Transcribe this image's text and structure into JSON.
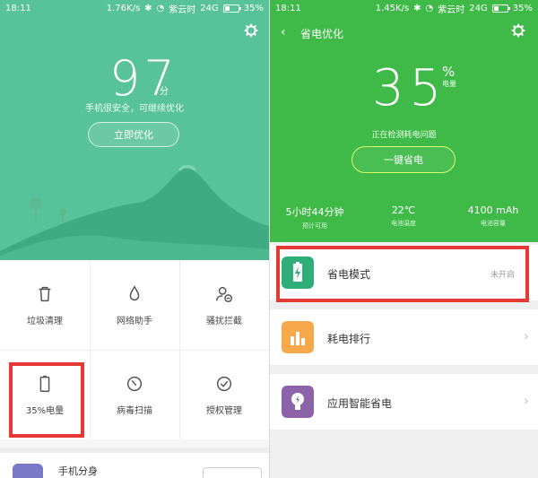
{
  "left": {
    "status": {
      "time": "18:11",
      "speed": "1.76K/s",
      "network": "紫云时",
      "signal": "24G",
      "battery": "35%"
    },
    "score": "97",
    "score_unit": "分",
    "subtitle": "手机很安全，可继续优化",
    "optimize_button": "立即优化",
    "grid": [
      {
        "label": "垃圾清理",
        "icon": "trash-icon"
      },
      {
        "label": "网络助手",
        "icon": "droplet-icon"
      },
      {
        "label": "骚扰拦截",
        "icon": "user-block-icon"
      },
      {
        "label": "35%电量",
        "icon": "battery-icon"
      },
      {
        "label": "病毒扫描",
        "icon": "scan-icon"
      },
      {
        "label": "授权管理",
        "icon": "check-circle-icon"
      }
    ],
    "bottom": {
      "title": "手机分身"
    }
  },
  "right": {
    "status": {
      "time": "18:11",
      "speed": "1.45K/s",
      "network": "紫云时",
      "signal": "24G",
      "battery": "35%"
    },
    "title": "省电优化",
    "battery_value": "35",
    "battery_unit": "%",
    "battery_sub": "电量",
    "checking": "正在检测耗电问题",
    "one_key": "一键省电",
    "stats": [
      {
        "value": "5小时44分钟",
        "label": "预计可用"
      },
      {
        "value": "22℃",
        "label": "电池温度"
      },
      {
        "value": "4100 mAh",
        "label": "电池容量"
      }
    ],
    "items": [
      {
        "title": "省电模式",
        "status": "未开启",
        "icon": "battery-bolt-icon",
        "color": "#2fae7a"
      },
      {
        "title": "耗电排行",
        "status": "",
        "icon": "bar-chart-icon",
        "color": "#f6a94a"
      },
      {
        "title": "应用智能省电",
        "status": "",
        "icon": "bulb-icon",
        "color": "#8c63a8"
      }
    ]
  },
  "colors": {
    "left_hero": "#58c29a",
    "right_header": "#3fba48",
    "highlight": "#e53935"
  }
}
